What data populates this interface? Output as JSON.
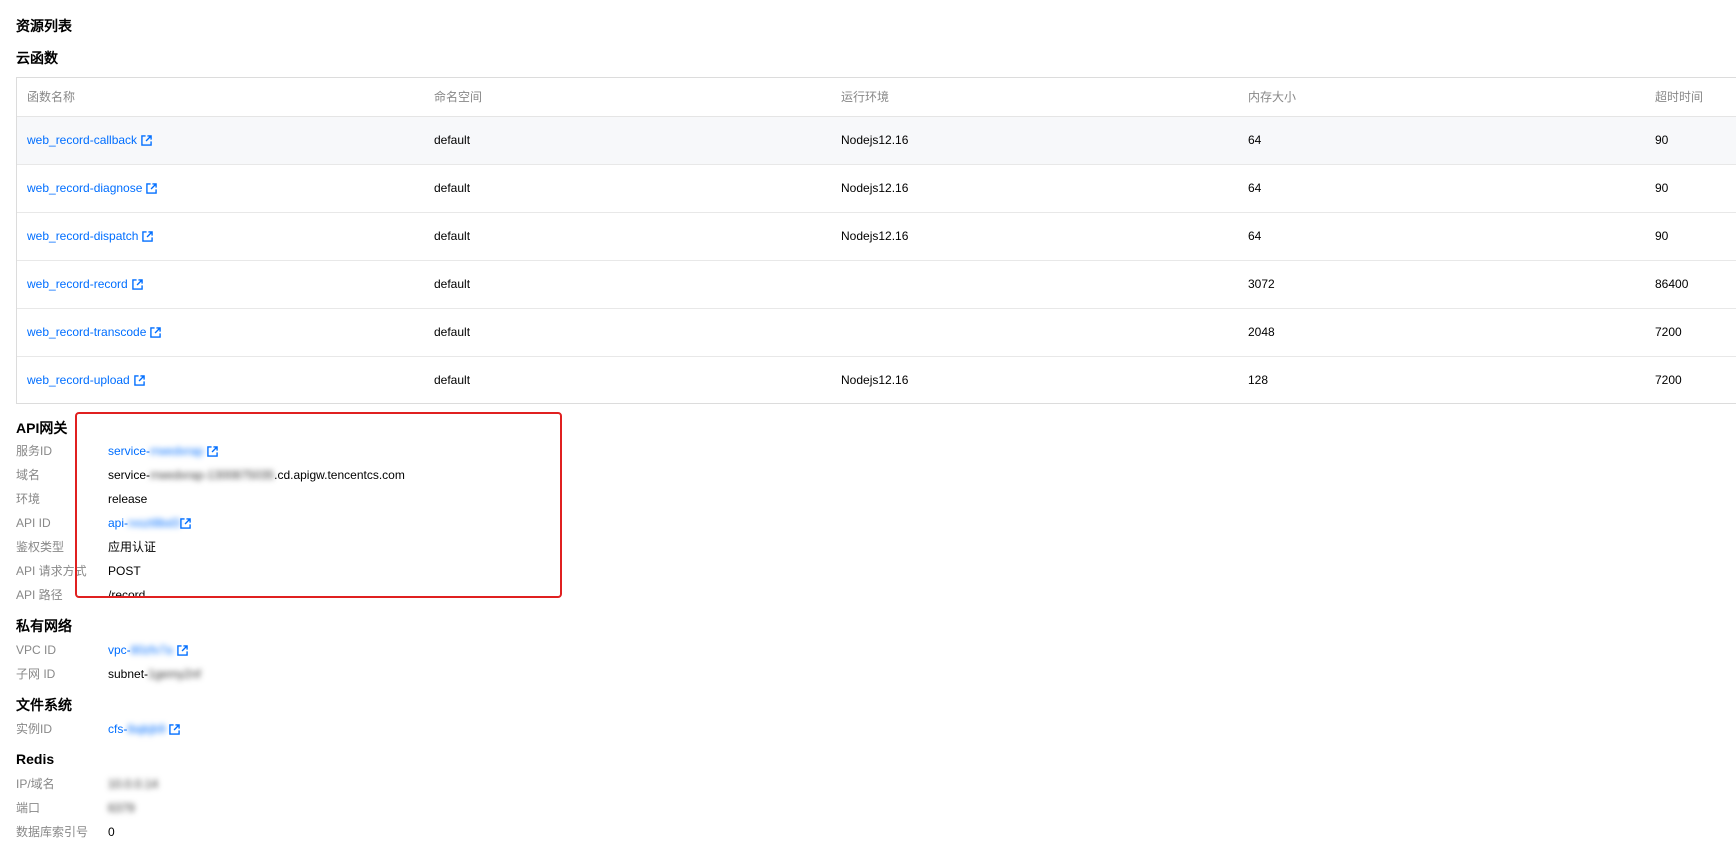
{
  "page_title": "资源列表",
  "cloud_functions": {
    "title": "云函数",
    "columns": [
      "函数名称",
      "命名空间",
      "运行环境",
      "内存大小",
      "超时时间"
    ],
    "rows": [
      [
        "web_record-callback",
        "default",
        "Nodejs12.16",
        "64",
        "90"
      ],
      [
        "web_record-diagnose",
        "default",
        "Nodejs12.16",
        "64",
        "90"
      ],
      [
        "web_record-dispatch",
        "default",
        "Nodejs12.16",
        "64",
        "90"
      ],
      [
        "web_record-record",
        "default",
        "",
        "3072",
        "86400"
      ],
      [
        "web_record-transcode",
        "default",
        "",
        "2048",
        "7200"
      ],
      [
        "web_record-upload",
        "default",
        "Nodejs12.16",
        "128",
        "7200"
      ]
    ]
  },
  "api_gateway": {
    "title": "API网关",
    "service_id_label": "服务ID",
    "service_id_prefix": "service-",
    "service_id_blurred": "rrwedvrap",
    "domain_label": "域名",
    "domain_prefix": "service-",
    "domain_blurred": "rrwedvrap-1300875035",
    "domain_suffix": ".cd.apigw.tencentcs.com",
    "env_label": "环境",
    "env_value": "release",
    "api_id_label": "API ID",
    "api_id_prefix": "api-",
    "api_id_blurred": "rxszt8bd3",
    "auth_label": "鉴权类型",
    "auth_value": "应用认证",
    "method_label": "API 请求方式",
    "method_value": "POST",
    "path_label": "API 路径",
    "path_value": "/record"
  },
  "vpc": {
    "title": "私有网络",
    "vpc_id_label": "VPC ID",
    "vpc_id_prefix": "vpc-",
    "vpc_id_blurred": "80zfv7a",
    "subnet_label": "子网 ID",
    "subnet_prefix": "subnet-",
    "subnet_blurred": "1gemy2nf"
  },
  "cfs": {
    "title": "文件系统",
    "instance_label": "实例ID",
    "instance_prefix": "cfs-",
    "instance_blurred": "8ajkjb9"
  },
  "redis": {
    "title": "Redis",
    "host_label": "IP/域名",
    "host_blurred": "10.0.0.14",
    "port_label": "端口",
    "port_blurred": "6379",
    "db_label": "数据库索引号",
    "db_value": "0"
  },
  "colors": {
    "link": "#006eff",
    "highlight": "#e02020",
    "label": "#888888"
  },
  "icons": {
    "external": "external-link-icon"
  }
}
